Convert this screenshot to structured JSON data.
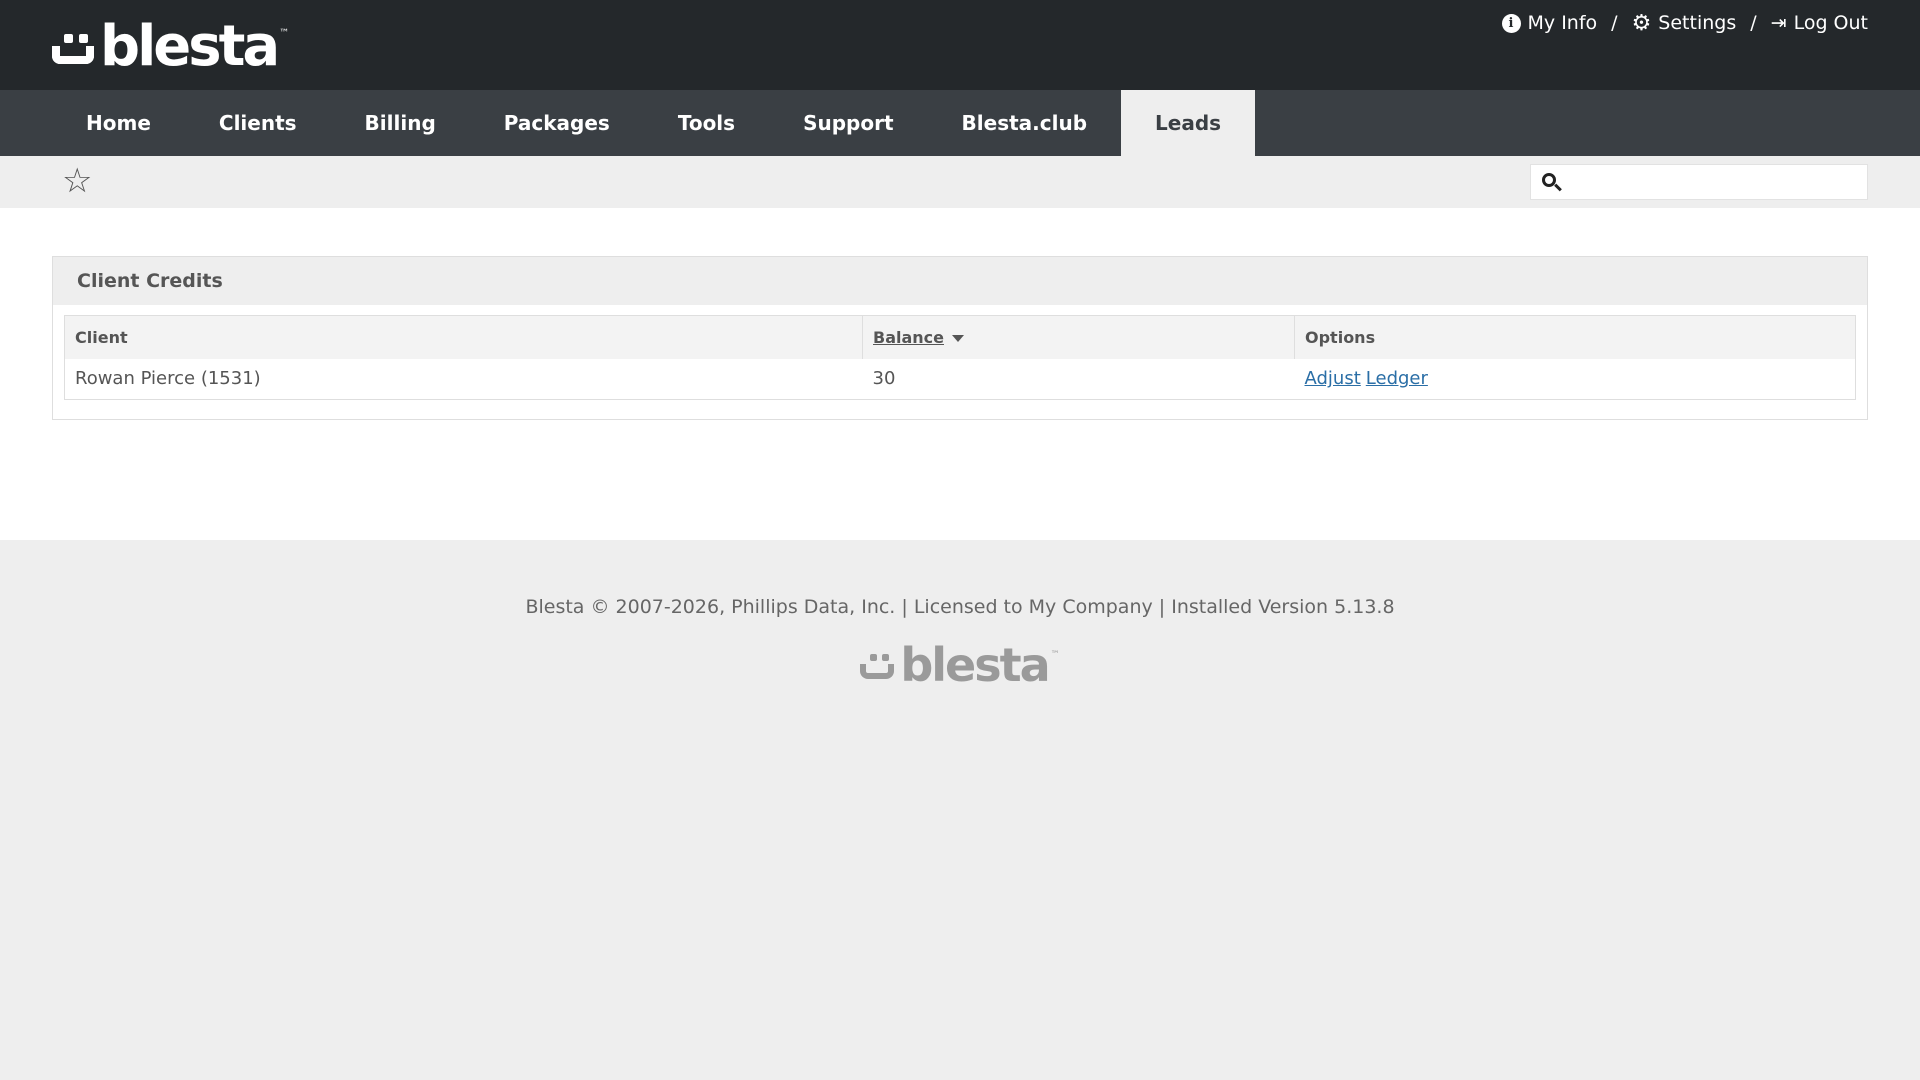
{
  "header": {
    "logo_text": "blesta",
    "logo_tm": "™",
    "links": {
      "my_info": "My Info",
      "settings": "Settings",
      "logout": "Log Out",
      "separator": "/"
    }
  },
  "nav": {
    "items": [
      "Home",
      "Clients",
      "Billing",
      "Packages",
      "Tools",
      "Support",
      "Blesta.club",
      "Leads"
    ],
    "active": "Leads"
  },
  "search": {
    "placeholder": "",
    "value": ""
  },
  "panel": {
    "title": "Client Credits",
    "columns": {
      "client": "Client",
      "balance": "Balance",
      "options": "Options"
    },
    "rows": [
      {
        "client": "Rowan Pierce (1531)",
        "balance": "30",
        "adjust": "Adjust",
        "ledger": "Ledger"
      }
    ]
  },
  "footer": {
    "text": "Blesta © 2007-2026, Phillips Data, Inc. | Licensed to My Company | Installed Version 5.13.8",
    "logo_text": "blesta",
    "logo_tm": "™"
  },
  "colors": {
    "header_bg": "#24282b",
    "nav_bg": "#3a3f44",
    "link": "#2a6ea6",
    "page_bg": "#eeeeee"
  }
}
